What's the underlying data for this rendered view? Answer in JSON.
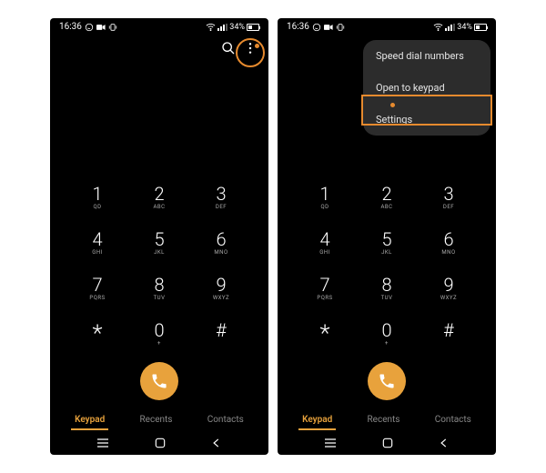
{
  "statusbar": {
    "time": "16:36",
    "battery_pct": "34%",
    "icons": {
      "whatsapp": "whatsapp-icon",
      "video": "video-icon",
      "vibrate": "vibrate-icon",
      "wifi": "wifi-icon",
      "signal": "signal-icon",
      "battery": "battery-icon"
    }
  },
  "topactions": {
    "search": "search-icon",
    "more": "more-icon"
  },
  "keypad": [
    {
      "digit": "1",
      "sub": "QD"
    },
    {
      "digit": "2",
      "sub": "ABC"
    },
    {
      "digit": "3",
      "sub": "DEF"
    },
    {
      "digit": "4",
      "sub": "GHI"
    },
    {
      "digit": "5",
      "sub": "JKL"
    },
    {
      "digit": "6",
      "sub": "MNO"
    },
    {
      "digit": "7",
      "sub": "PQRS"
    },
    {
      "digit": "8",
      "sub": "TUV"
    },
    {
      "digit": "9",
      "sub": "WXYZ"
    },
    {
      "digit": "*",
      "sub": ""
    },
    {
      "digit": "0",
      "sub": "+"
    },
    {
      "digit": "#",
      "sub": ""
    }
  ],
  "call": {
    "icon": "phone-icon"
  },
  "tabs": [
    {
      "label": "Keypad",
      "active": true
    },
    {
      "label": "Recents",
      "active": false
    },
    {
      "label": "Contacts",
      "active": false
    }
  ],
  "nav": {
    "recents": "recents-nav-icon",
    "home": "home-nav-icon",
    "back": "back-nav-icon"
  },
  "menu": [
    {
      "label": "Speed dial numbers"
    },
    {
      "label": "Open to keypad"
    },
    {
      "label": "Settings"
    }
  ],
  "colors": {
    "accent": "#e8a23c",
    "highlight": "#e68a2e",
    "menu_bg": "#2c2c2c"
  }
}
